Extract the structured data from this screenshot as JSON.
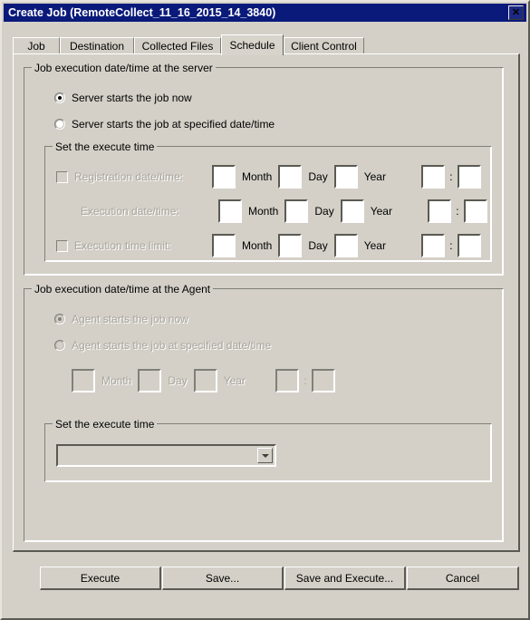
{
  "window": {
    "title": "Create Job (RemoteCollect_11_16_2015_14_3840)",
    "close_icon": "close-icon",
    "close_glyph": "✕"
  },
  "tabs": [
    {
      "label": "Job",
      "active": false
    },
    {
      "label": "Destination",
      "active": false
    },
    {
      "label": "Collected Files",
      "active": false
    },
    {
      "label": "Schedule",
      "active": true
    },
    {
      "label": "Client Control",
      "active": false
    }
  ],
  "server_group": {
    "title": "Job execution date/time at the server",
    "radios": [
      {
        "label": "Server starts the job now",
        "checked": true,
        "disabled": false
      },
      {
        "label": "Server starts the job at specified date/time",
        "checked": false,
        "disabled": false
      }
    ],
    "execute_time_group": {
      "title": "Set the execute time",
      "rows": [
        {
          "has_checkbox": true,
          "checked": false,
          "label": "Registration date/time:",
          "label_disabled": true,
          "month_label": "Month",
          "day_label": "Day",
          "year_label": "Year",
          "month_value": "",
          "day_value": "",
          "year_value": "",
          "hour_value": "",
          "minute_value": "",
          "separator": ":",
          "fields_disabled": false
        },
        {
          "has_checkbox": false,
          "checked": false,
          "label": "Execution date/time:",
          "label_disabled": true,
          "month_label": "Month",
          "day_label": "Day",
          "year_label": "Year",
          "month_value": "",
          "day_value": "",
          "year_value": "",
          "hour_value": "",
          "minute_value": "",
          "separator": ":",
          "fields_disabled": false
        },
        {
          "has_checkbox": true,
          "checked": false,
          "label": "Execution time limit:",
          "label_disabled": true,
          "month_label": "Month",
          "day_label": "Day",
          "year_label": "Year",
          "month_value": "",
          "day_value": "",
          "year_value": "",
          "hour_value": "",
          "minute_value": "",
          "separator": ":",
          "fields_disabled": false
        }
      ]
    }
  },
  "agent_group": {
    "title": "Job execution date/time at the Agent",
    "radios": [
      {
        "label": "Agent starts the job now",
        "checked": true,
        "disabled": true
      },
      {
        "label": "Agent starts the job at specified date/time",
        "checked": false,
        "disabled": true
      }
    ],
    "date_row": {
      "month_label": "Month",
      "day_label": "Day",
      "year_label": "Year",
      "month_value": "",
      "day_value": "",
      "year_value": "",
      "hour_value": "",
      "minute_value": "",
      "separator": ":",
      "fields_disabled": true
    },
    "execute_time_group": {
      "title": "Set the execute time",
      "combo_value": "",
      "combo_arrow_icon": "chevron-down-icon"
    }
  },
  "buttons": [
    {
      "label": "Execute"
    },
    {
      "label": "Save..."
    },
    {
      "label": "Save and Execute..."
    },
    {
      "label": "Cancel"
    }
  ],
  "colors": {
    "face": "#d4d0c8",
    "titlebar": "#0a1a7a",
    "disabled_text": "#a8a49c",
    "shadow": "#5a5a52"
  }
}
